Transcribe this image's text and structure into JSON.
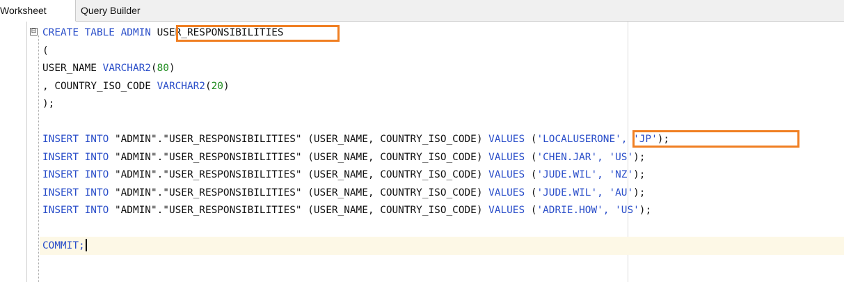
{
  "tabs": [
    {
      "label": "Worksheet",
      "active": true
    },
    {
      "label": "Query Builder",
      "active": false
    }
  ],
  "editor": {
    "fold_symbol": "⊟",
    "create": {
      "line1": {
        "kw": "CREATE TABLE",
        "schema": "ADMIN",
        "table": "USER_RESPONSIBILITIES"
      },
      "line2": "(",
      "line3": {
        "col": "USER_NAME",
        "type": "VARCHAR2",
        "open": "(",
        "size": "80",
        "close": ")"
      },
      "line4": {
        "prefix": ",",
        "col": "COUNTRY_ISO_CODE",
        "type": "VARCHAR2",
        "open": "(",
        "size": "20",
        "close": ")"
      },
      "line5": ");"
    },
    "insert_keywords": "INSERT INTO",
    "insert_target": "\"ADMIN\".\"USER_RESPONSIBILITIES\" (USER_NAME, COUNTRY_ISO_CODE)",
    "values_keyword": "VALUES",
    "inserts": [
      {
        "open": "(",
        "values": "'LOCALUSERONE', 'JP'",
        "close": ");"
      },
      {
        "open": "(",
        "values": "'CHEN.JAR', 'US'",
        "close": ");"
      },
      {
        "open": "(",
        "values": "'JUDE.WIL', 'NZ'",
        "close": ");"
      },
      {
        "open": "(",
        "values": "'JUDE.WIL', 'AU'",
        "close": ");"
      },
      {
        "open": "(",
        "values": "'ADRIE.HOW', 'US'",
        "close": ");"
      }
    ],
    "commit": "COMMIT;"
  },
  "colors": {
    "keyword": "#2a4ec9",
    "number": "#1e8c1e",
    "highlight_box": "#f07f22",
    "current_line": "#fdf8e6"
  }
}
